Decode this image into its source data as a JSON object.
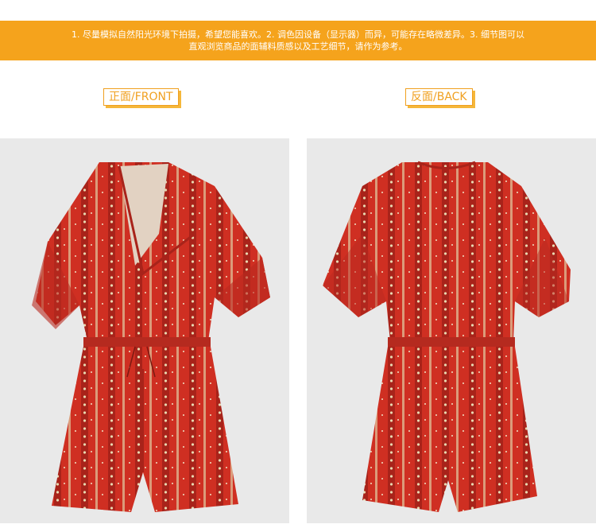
{
  "banner": {
    "line1": "1. 尽量模拟自然阳光环境下拍摄，希望您能喜欢。2. 调色因设备（显示器）而异，可能存在略微差异。3. 细节图可以",
    "line2": "直观浏览商品的面辅料质感以及工艺细节，请作为参考。"
  },
  "labels": {
    "front": "正面/FRONT",
    "back": "反面/BACK"
  },
  "colors": {
    "banner": "#f5a31c",
    "label": "#f0a020",
    "garment": "#cf2f22",
    "garment_dark": "#a8231a",
    "photo_bg": "#e9e9e9"
  },
  "photos": {
    "front": {
      "icon": "romper-front-image"
    },
    "back": {
      "icon": "romper-back-image"
    }
  }
}
